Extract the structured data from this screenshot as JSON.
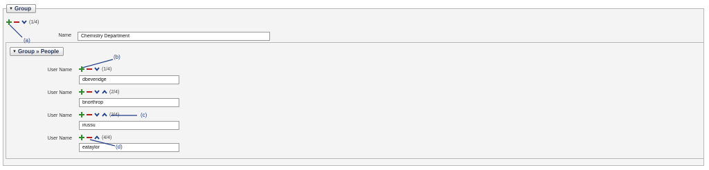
{
  "group": {
    "legend": "Group",
    "counter": "(1/4)",
    "name_label": "Name",
    "name_value": "Chemistry Department"
  },
  "people": {
    "legend": "Group » People",
    "rows": [
      {
        "label": "User Name",
        "counter": "(1/4)",
        "value": "dbeveridge"
      },
      {
        "label": "User Name",
        "counter": "(2/4)",
        "value": "bnorthrop"
      },
      {
        "label": "User Name",
        "counter": "(3/4)",
        "value": "irussu"
      },
      {
        "label": "User Name",
        "counter": "(4/4)",
        "value": "eataylor"
      }
    ]
  },
  "annotations": {
    "a": "(a)",
    "b": "(b)",
    "c": "(c)",
    "d": "(d)"
  },
  "icons": {
    "legend_toggle": "triangle-down-icon",
    "add": "plus-icon",
    "remove": "minus-icon",
    "move_down": "chevron-down-icon",
    "move_up": "chevron-up-icon"
  },
  "colors": {
    "add": "#2e8b2a",
    "remove": "#b51d1d",
    "chevron": "#1f3d8a",
    "annotation": "#1f3d8a"
  }
}
